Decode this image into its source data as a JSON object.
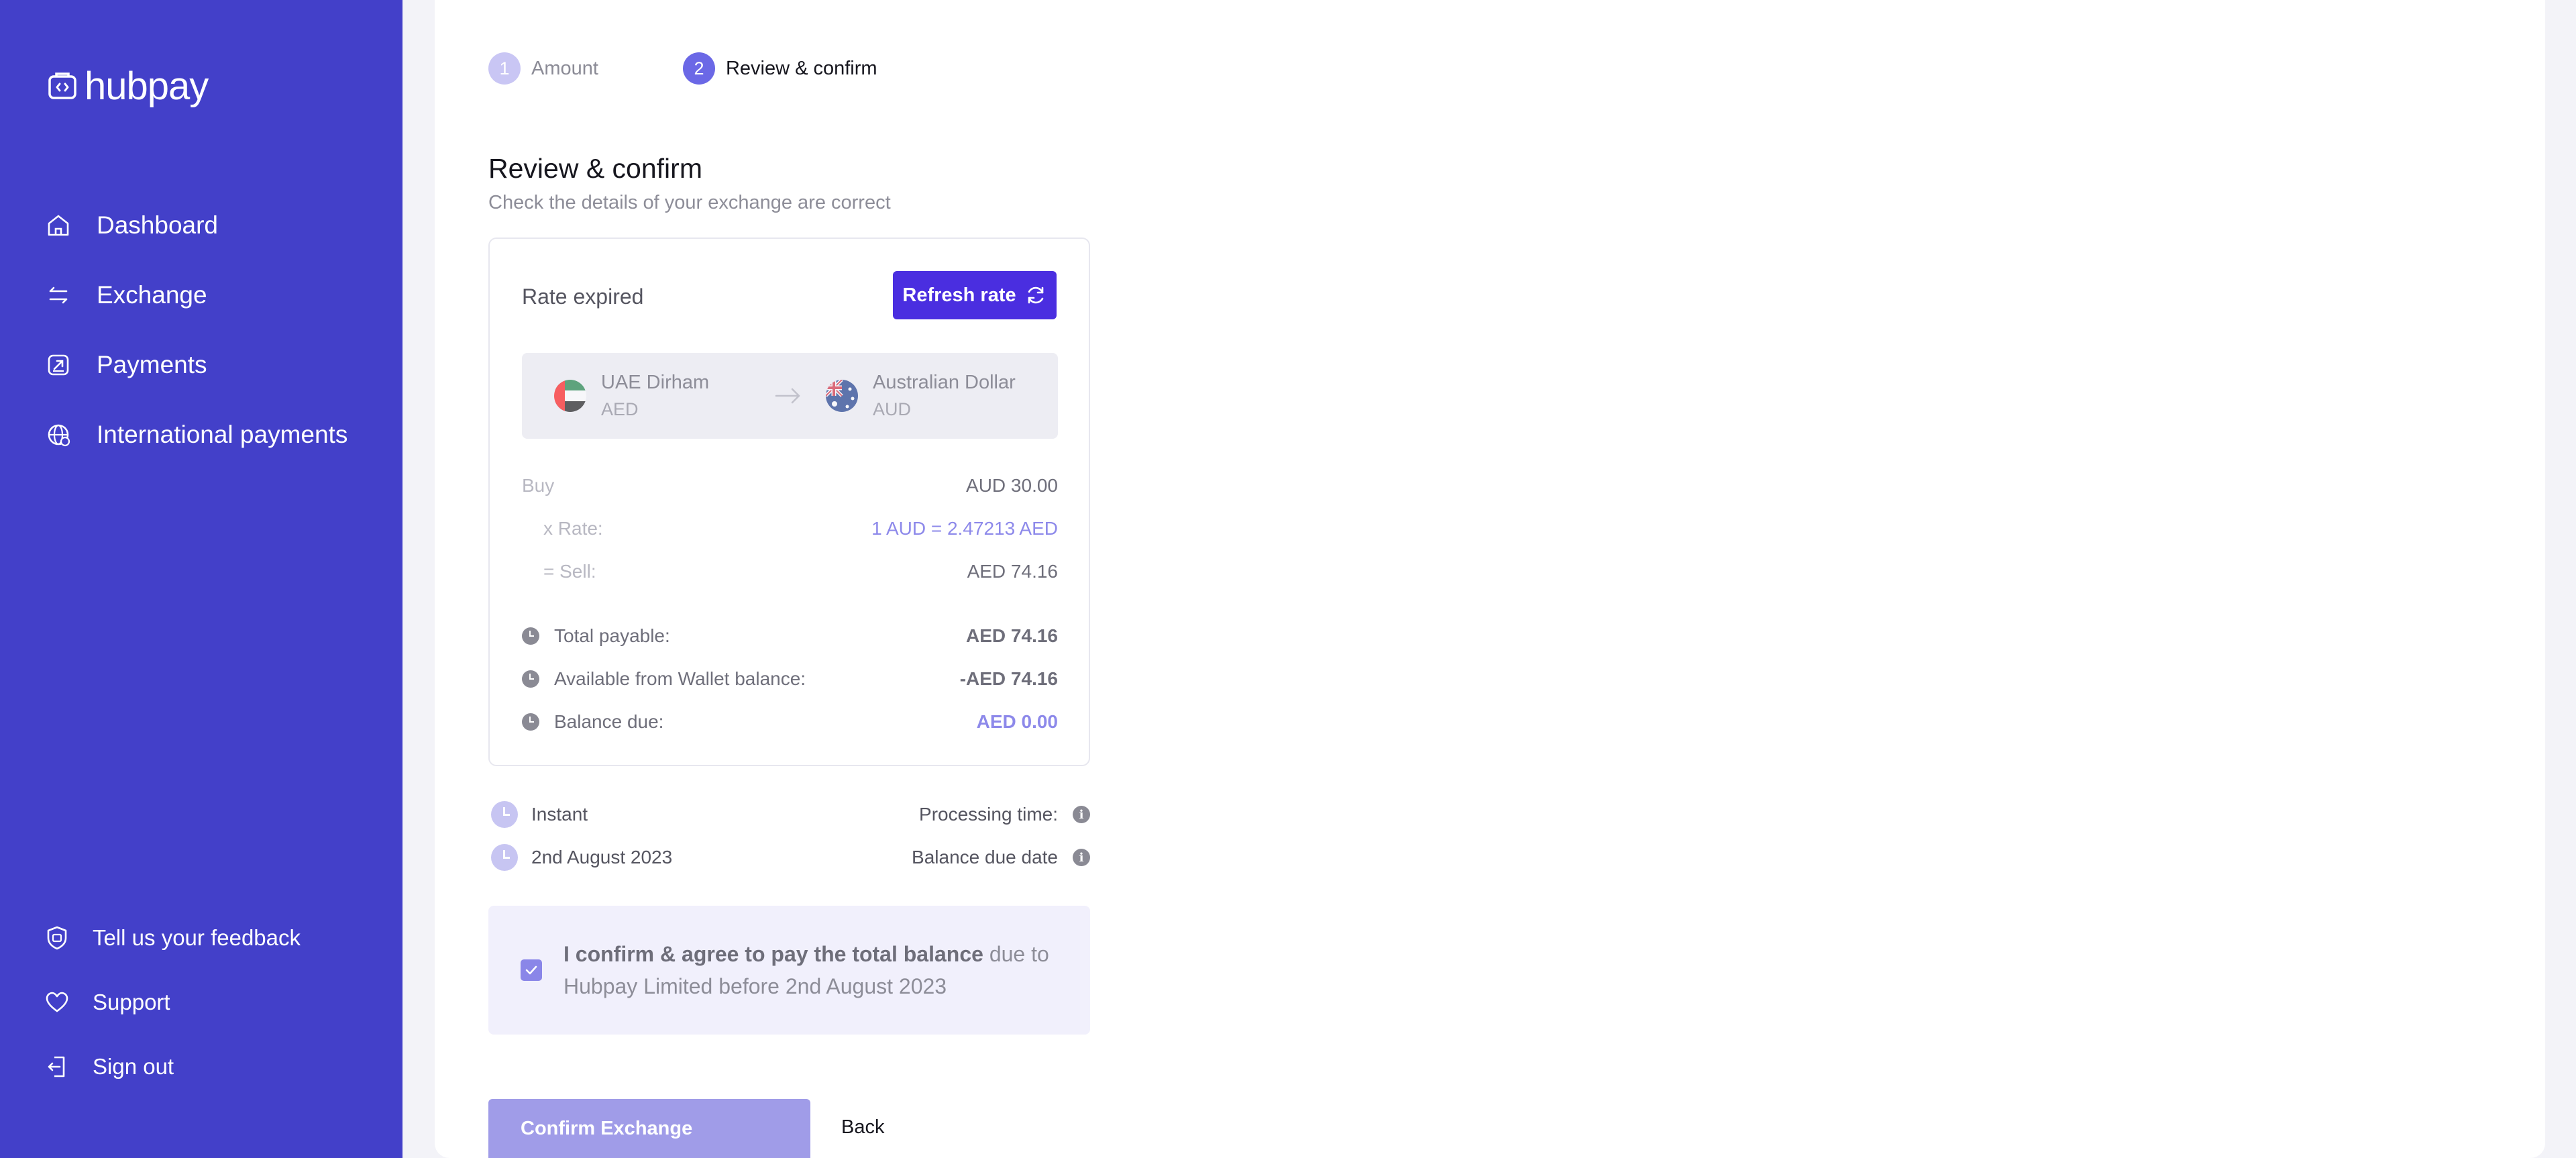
{
  "brand": {
    "name": "hubpay",
    "color": "#4340c9",
    "accent": "#4a2ee0"
  },
  "sidebar": {
    "items": [
      {
        "label": "Dashboard",
        "icon": "home-icon"
      },
      {
        "label": "Exchange",
        "icon": "exchange-arrows-icon"
      },
      {
        "label": "Payments",
        "icon": "payments-icon"
      },
      {
        "label": "International payments",
        "icon": "globe-icon"
      }
    ],
    "bottom_items": [
      {
        "label": "Tell us your feedback",
        "icon": "feedback-icon"
      },
      {
        "label": "Support",
        "icon": "heart-icon"
      },
      {
        "label": "Sign out",
        "icon": "sign-out-icon"
      }
    ]
  },
  "stepper": {
    "steps": [
      {
        "number": "1",
        "label": "Amount",
        "active": false
      },
      {
        "number": "2",
        "label": "Review & confirm",
        "active": true
      }
    ]
  },
  "page": {
    "title": "Review & confirm",
    "subtitle": "Check the details of your exchange are correct"
  },
  "review": {
    "status": "Rate expired",
    "refresh_label": "Refresh rate",
    "from": {
      "name": "UAE Dirham",
      "code": "AED"
    },
    "to": {
      "name": "Australian Dollar",
      "code": "AUD"
    },
    "buy_label": "Buy",
    "buy_value": "AUD 30.00",
    "rate_label": "x Rate:",
    "rate_value": "1 AUD = 2.47213 AED",
    "sell_label": "= Sell:",
    "sell_value": "AED 74.16",
    "total_label": "Total payable:",
    "total_value": "AED 74.16",
    "wallet_label": "Available from Wallet balance:",
    "wallet_value": "-AED 74.16",
    "due_label": "Balance due:",
    "due_value": "AED 0.00"
  },
  "meta": {
    "processing_value": "Instant",
    "processing_label": "Processing time:",
    "due_date_value": "2nd August 2023",
    "due_date_label": "Balance due date"
  },
  "agreement": {
    "checked": true,
    "bold_text": "I confirm & agree to pay the total balance",
    "rest_text": " due to Hubpay Limited before 2nd August 2023"
  },
  "actions": {
    "confirm_label": "Confirm Exchange",
    "back_label": "Back"
  }
}
